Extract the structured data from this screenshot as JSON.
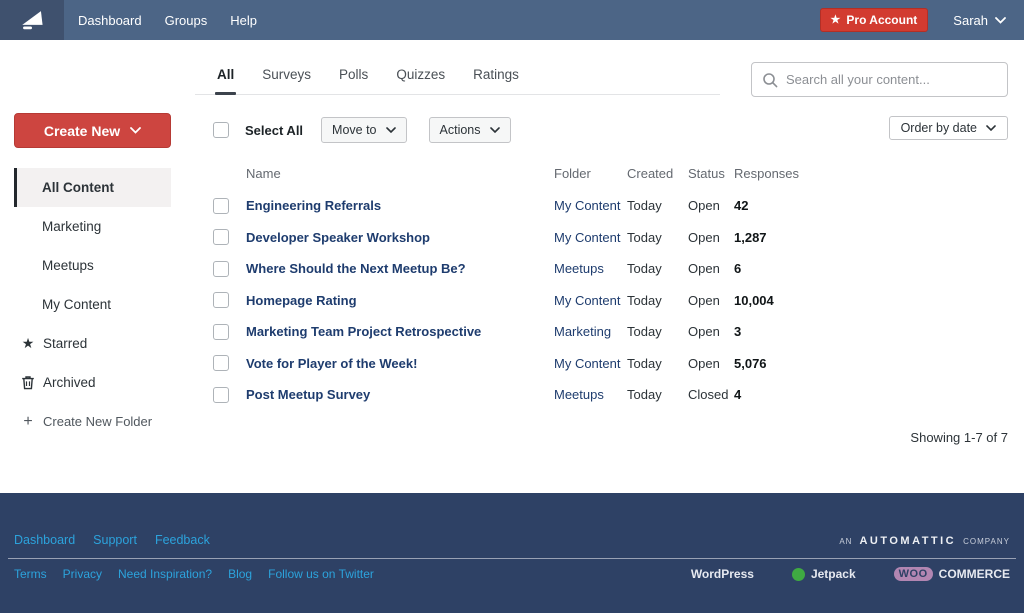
{
  "navbar": {
    "items": [
      {
        "label": "Dashboard"
      },
      {
        "label": "Groups"
      },
      {
        "label": "Help"
      }
    ],
    "pro_button_label": "Pro Account",
    "user_name": "Sarah"
  },
  "tabs": {
    "items": [
      {
        "label": "All",
        "active": true
      },
      {
        "label": "Surveys",
        "active": false
      },
      {
        "label": "Polls",
        "active": false
      },
      {
        "label": "Quizzes",
        "active": false
      },
      {
        "label": "Ratings",
        "active": false
      }
    ]
  },
  "search": {
    "placeholder": "Search all your content..."
  },
  "toolbar": {
    "create_new_label": "Create New",
    "select_all_label": "Select All",
    "move_to_label": "Move to",
    "actions_label": "Actions",
    "order_by_label": "Order by date"
  },
  "sidebar": {
    "folders": [
      {
        "label": "All Content",
        "active": true
      },
      {
        "label": "Marketing",
        "active": false
      },
      {
        "label": "Meetups",
        "active": false
      },
      {
        "label": "My Content",
        "active": false
      }
    ],
    "starred_label": "Starred",
    "archived_label": "Archived",
    "create_folder_label": "Create New Folder"
  },
  "table": {
    "columns": [
      "Name",
      "Folder",
      "Created",
      "Status",
      "Responses"
    ],
    "rows": [
      {
        "name": "Engineering Referrals",
        "folder": "My Content",
        "created": "Today",
        "status": "Open",
        "responses": "42"
      },
      {
        "name": "Developer Speaker Workshop",
        "folder": "My Content",
        "created": "Today",
        "status": "Open",
        "responses": "1,287"
      },
      {
        "name": "Where Should the Next Meetup Be?",
        "folder": "Meetups",
        "created": "Today",
        "status": "Open",
        "responses": "6"
      },
      {
        "name": "Homepage Rating",
        "folder": "My Content",
        "created": "Today",
        "status": "Open",
        "responses": "10,004"
      },
      {
        "name": "Marketing Team Project Retrospective",
        "folder": "Marketing",
        "created": "Today",
        "status": "Open",
        "responses": "3"
      },
      {
        "name": "Vote for Player of the Week!",
        "folder": "My Content",
        "created": "Today",
        "status": "Open",
        "responses": "5,076"
      },
      {
        "name": "Post Meetup Survey",
        "folder": "Meetups",
        "created": "Today",
        "status": "Closed",
        "responses": "4"
      }
    ]
  },
  "pagination": {
    "summary": "Showing 1-7 of 7"
  },
  "footer": {
    "links": [
      {
        "label": "Dashboard"
      },
      {
        "label": "Support"
      },
      {
        "label": "Feedback"
      }
    ],
    "automattic": {
      "prefix": "AN",
      "brand": "AUTOMATTIC",
      "suffix": "COMPANY"
    },
    "bottom_links": [
      {
        "label": "Terms"
      },
      {
        "label": "Privacy"
      },
      {
        "label": "Need Inspiration?"
      },
      {
        "label": "Blog"
      },
      {
        "label": "Follow us on Twitter"
      }
    ],
    "bottom_brands": {
      "wordpress": "WordPress",
      "jetpack": "Jetpack",
      "woo_prefix": "WOO",
      "woo_suffix": "COMMERCE"
    }
  },
  "colors": {
    "navbar_blue": "#4c6586",
    "brand_square_blue": "#3f516e",
    "accent_red": "#cd4540",
    "footer_navy": "#2e4165",
    "link_navy": "#1e3c6e",
    "footer_link_blue": "#2ca3dc"
  }
}
